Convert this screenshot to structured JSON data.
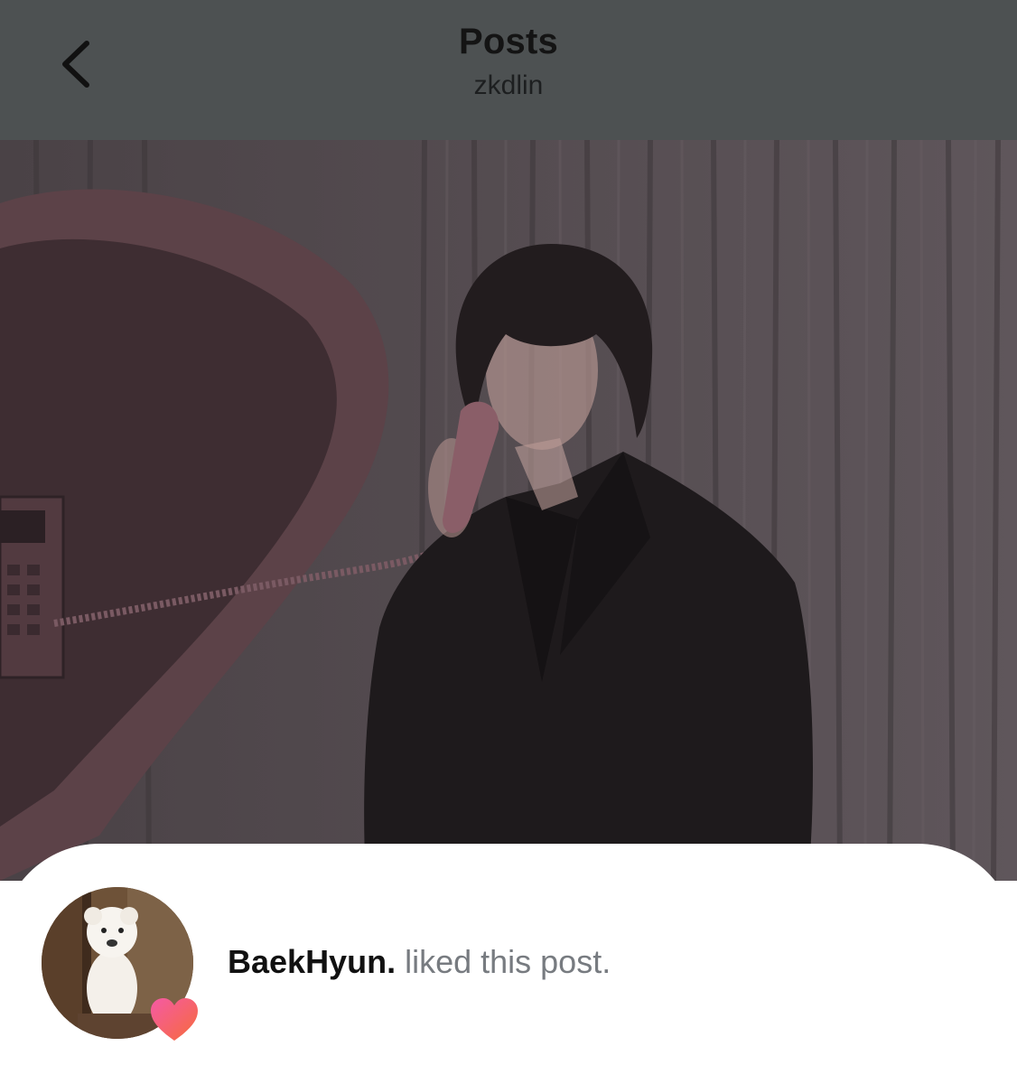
{
  "header": {
    "title": "Posts",
    "subtitle": "zkdlin",
    "back_icon": "chevron-left-icon"
  },
  "post": {
    "image_description_icon": "photo"
  },
  "notification": {
    "username": "BaekHyun.",
    "action_text": " liked this post.",
    "avatar_icon": "avatar",
    "badge_icon": "heart-icon",
    "badge_color": "#f0566b"
  }
}
